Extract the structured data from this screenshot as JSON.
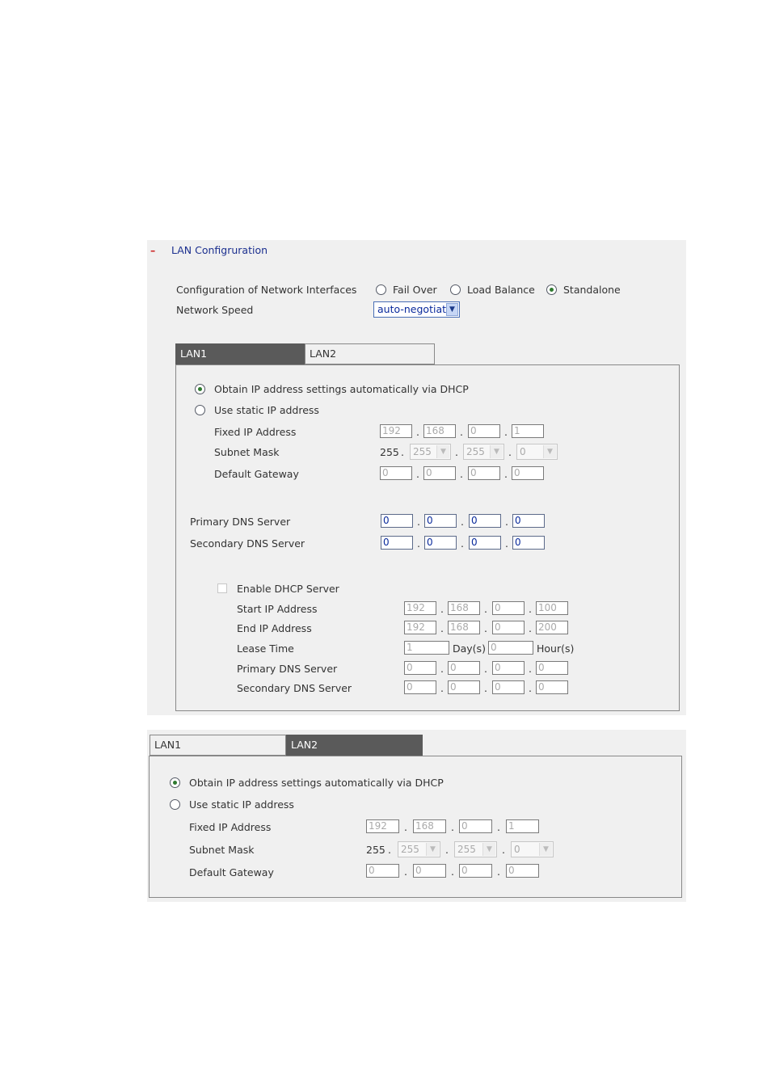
{
  "header": {
    "collapse_symbol": "–",
    "title": "LAN Configruration"
  },
  "interfaces": {
    "label": "Configuration of Network Interfaces",
    "options": [
      "Fail Over",
      "Load Balance",
      "Standalone"
    ],
    "selected": "Standalone"
  },
  "network_speed": {
    "label": "Network Speed",
    "value": "auto-negotiat"
  },
  "tabs": [
    "LAN1",
    "LAN2"
  ],
  "lan1": {
    "dhcp_label": "Obtain IP address settings automatically via DHCP",
    "static_label": "Use static IP address",
    "selected": "dhcp",
    "fixed_ip": {
      "label": "Fixed IP Address",
      "values": [
        "192",
        "168",
        "0",
        "1"
      ]
    },
    "subnet": {
      "label": "Subnet Mask",
      "first": "255",
      "values": [
        "255",
        "255",
        "0"
      ]
    },
    "gateway": {
      "label": "Default Gateway",
      "values": [
        "0",
        "0",
        "0",
        "0"
      ]
    },
    "primary_dns": {
      "label": "Primary DNS Server",
      "values": [
        "0",
        "0",
        "0",
        "0"
      ]
    },
    "secondary_dns": {
      "label": "Secondary DNS Server",
      "values": [
        "0",
        "0",
        "0",
        "0"
      ]
    },
    "dhcp_server": {
      "enable_label": "Enable DHCP Server",
      "enabled": false,
      "start_ip": {
        "label": "Start IP Address",
        "values": [
          "192",
          "168",
          "0",
          "100"
        ]
      },
      "end_ip": {
        "label": "End IP Address",
        "values": [
          "192",
          "168",
          "0",
          "200"
        ]
      },
      "lease": {
        "label": "Lease Time",
        "days": "1",
        "days_unit": "Day(s)",
        "hours": "0",
        "hours_unit": "Hour(s)"
      },
      "primary_dns": {
        "label": "Primary DNS Server",
        "values": [
          "0",
          "0",
          "0",
          "0"
        ]
      },
      "secondary_dns": {
        "label": "Secondary DNS Server",
        "values": [
          "0",
          "0",
          "0",
          "0"
        ]
      }
    }
  },
  "lan2": {
    "dhcp_label": "Obtain IP address settings automatically via DHCP",
    "static_label": "Use static IP address",
    "selected": "dhcp",
    "fixed_ip": {
      "label": "Fixed IP Address",
      "values": [
        "192",
        "168",
        "0",
        "1"
      ]
    },
    "subnet": {
      "label": "Subnet Mask",
      "first": "255",
      "values": [
        "255",
        "255",
        "0"
      ]
    },
    "gateway": {
      "label": "Default Gateway",
      "values": [
        "0",
        "0",
        "0",
        "0"
      ]
    }
  },
  "colors": {
    "accent_text": "#1b2f8f",
    "collapse": "#cc2222",
    "active_tab": "#5a5a5a",
    "panel_bg": "#f0f0f0"
  },
  "icons": {
    "dropdown": "chevron-down-icon",
    "radio": "radio-icon",
    "checkbox": "checkbox-icon"
  }
}
